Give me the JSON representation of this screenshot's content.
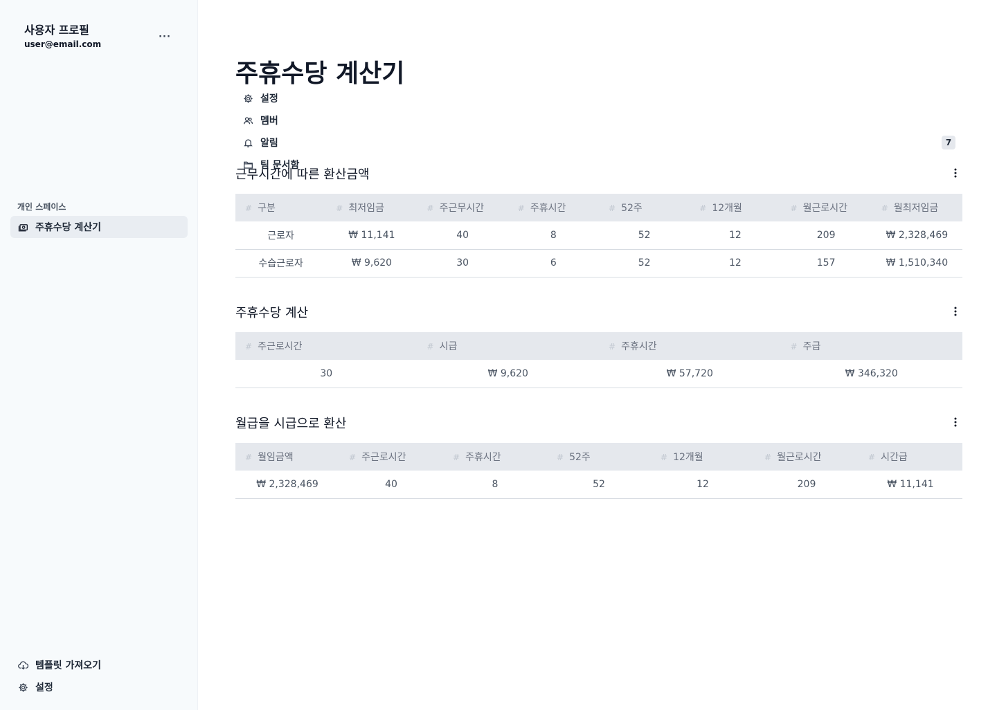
{
  "sidebar": {
    "profile": {
      "name": "사용자 프로필",
      "email": "user@email.com",
      "more": "···"
    },
    "nav": [
      {
        "label": "설정",
        "icon": "gear-icon"
      },
      {
        "label": "멤버",
        "icon": "users-icon"
      },
      {
        "label": "알림",
        "icon": "bell-icon",
        "badge": "7"
      },
      {
        "label": "팀 문서함",
        "icon": "folder-icon"
      }
    ],
    "section_label": "개인 스페이스",
    "space_items": [
      {
        "label": "주휴수당 계산기",
        "icon": "money-icon",
        "active": true
      }
    ],
    "bottom": [
      {
        "label": "템플릿 가져오기",
        "icon": "cloud-download-icon"
      },
      {
        "label": "설정",
        "icon": "gear-icon"
      }
    ]
  },
  "main": {
    "title": "주휴수당 계산기",
    "tables": [
      {
        "title": "근무시간에 따른 환산금액",
        "columns": [
          "구분",
          "최저임금",
          "주근무시간",
          "주휴시간",
          "52주",
          "12개월",
          "월근로시간",
          "월최저임금"
        ],
        "rows": [
          [
            "근로자",
            "₩ 11,141",
            "40",
            "8",
            "52",
            "12",
            "209",
            "₩ 2,328,469"
          ],
          [
            "수습근로자",
            "₩ 9,620",
            "30",
            "6",
            "52",
            "12",
            "157",
            "₩ 1,510,340"
          ]
        ]
      },
      {
        "title": "주휴수당 계산",
        "columns": [
          "주근로시간",
          "시급",
          "주휴시간",
          "주급"
        ],
        "rows": [
          [
            "30",
            "₩ 9,620",
            "₩ 57,720",
            "₩ 346,320"
          ]
        ]
      },
      {
        "title": "월급을 시급으로 환산",
        "columns": [
          "월임금액",
          "주근로시간",
          "주휴시간",
          "52주",
          "12개월",
          "월근로시간",
          "시간급"
        ],
        "rows": [
          [
            "₩ 2,328,469",
            "40",
            "8",
            "52",
            "12",
            "209",
            "₩ 11,141"
          ]
        ]
      }
    ]
  }
}
